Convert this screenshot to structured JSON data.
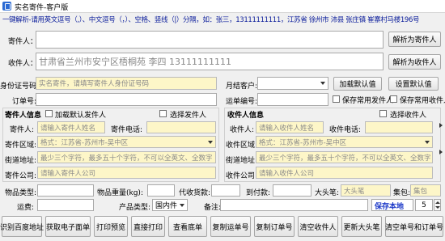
{
  "window": {
    "title": "实名寄件-客户版"
  },
  "tip": "一键解析-请用英文逗号（,）、中文逗号（，）、空格、竖线（|）分隔，如：张三，13111111111，江苏省 徐州市 沛县 张庄镇 崔寨村马楼196号",
  "sender_row": {
    "label": "寄件人：",
    "value": "",
    "button": "解析为寄件人"
  },
  "receiver_row": {
    "label": "收件人：",
    "value": "甘肃省兰州市安宁区梧桐苑  李四 13111111111",
    "button": "解析为收件人"
  },
  "id_row": {
    "label": "身份证号码:",
    "placeholder": "实名寄件，请填写寄件人身份证号码",
    "monthly_label": "月结客户:",
    "load_default": "加载默认值",
    "set_default": "设置默认值"
  },
  "order_row": {
    "label": "订单号:",
    "waybill_label": "运单编号:",
    "save_sender": "保存常用发件人",
    "save_receiver": "保存常用收件人"
  },
  "sender_info": {
    "title": "寄件人信息",
    "load_default": "加载默认发件人",
    "select": "选择发件人",
    "name_label": "寄件人:",
    "name_placeholder": "请输入寄件人姓名",
    "phone_label": "寄件电话:",
    "region_label": "寄件区域:",
    "region_placeholder": "格式：江苏省-苏州市-吴中区",
    "street_label": "街道地址:",
    "street_placeholder": "最少三个字符，最多五十个字符，不可以全英文、全数字",
    "company_label": "寄件公司:",
    "company_placeholder": "请输入寄件人公司"
  },
  "receiver_info": {
    "title": "收件人信息",
    "select": "选择收件人",
    "name_label": "收件人:",
    "name_placeholder": "请输入收件人姓名",
    "phone_label": "收件电话:",
    "region_label": "收件区域:",
    "region_placeholder": "格式：江苏省-苏州市-吴中区",
    "street_label": "街道地址:",
    "street_placeholder": "最少三个字符，最多五十个字符，不可以全英文、全数字",
    "company_label": "收件公司:",
    "company_placeholder": "请输入收件人公司"
  },
  "goods": {
    "type_label": "物品类型:",
    "weight_label": "物品重量(kg):",
    "collect_label": "代收货款:",
    "arrive_label": "到付款:",
    "big_head_label": "大头笔:",
    "big_head_placeholder": "大头笔",
    "package_label": "集包:",
    "package_placeholder": "集包",
    "freight_label": "运费:",
    "product_label": "产品类型:",
    "product_value": "国内件",
    "remark_label": "备注:",
    "save_local": "保存本地",
    "save_count": "5"
  },
  "buttons": [
    "识别百度地址",
    "获取电子面单",
    "打印预览",
    "直接打印",
    "查看底单",
    "复制运单号",
    "复制订单号",
    "清空收件人",
    "更新大头笔",
    "清空单号和订单号"
  ]
}
